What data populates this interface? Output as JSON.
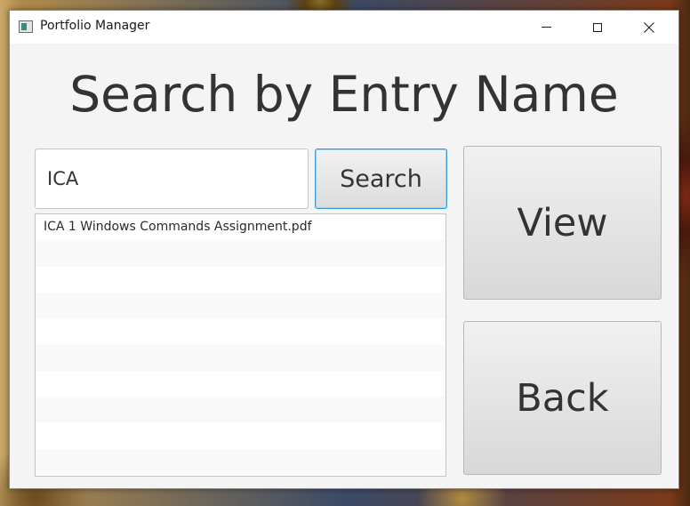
{
  "window": {
    "title": "Portfolio Manager",
    "icon": "app-icon"
  },
  "controls": {
    "minimize_icon": "minimize-icon",
    "maximize_icon": "maximize-icon",
    "close_icon": "close-icon"
  },
  "heading": "Search by Entry Name",
  "search": {
    "value": "ICA",
    "placeholder": "",
    "button_label": "Search"
  },
  "results": {
    "items": [
      "ICA 1 Windows Commands Assignment.pdf",
      "",
      "",
      "",
      "",
      "",
      "",
      "",
      "",
      ""
    ]
  },
  "actions": {
    "view_label": "View",
    "back_label": "Back"
  },
  "colors": {
    "focus_border": "#3a9ad9",
    "window_bg": "#f4f4f4",
    "text": "#333333"
  }
}
